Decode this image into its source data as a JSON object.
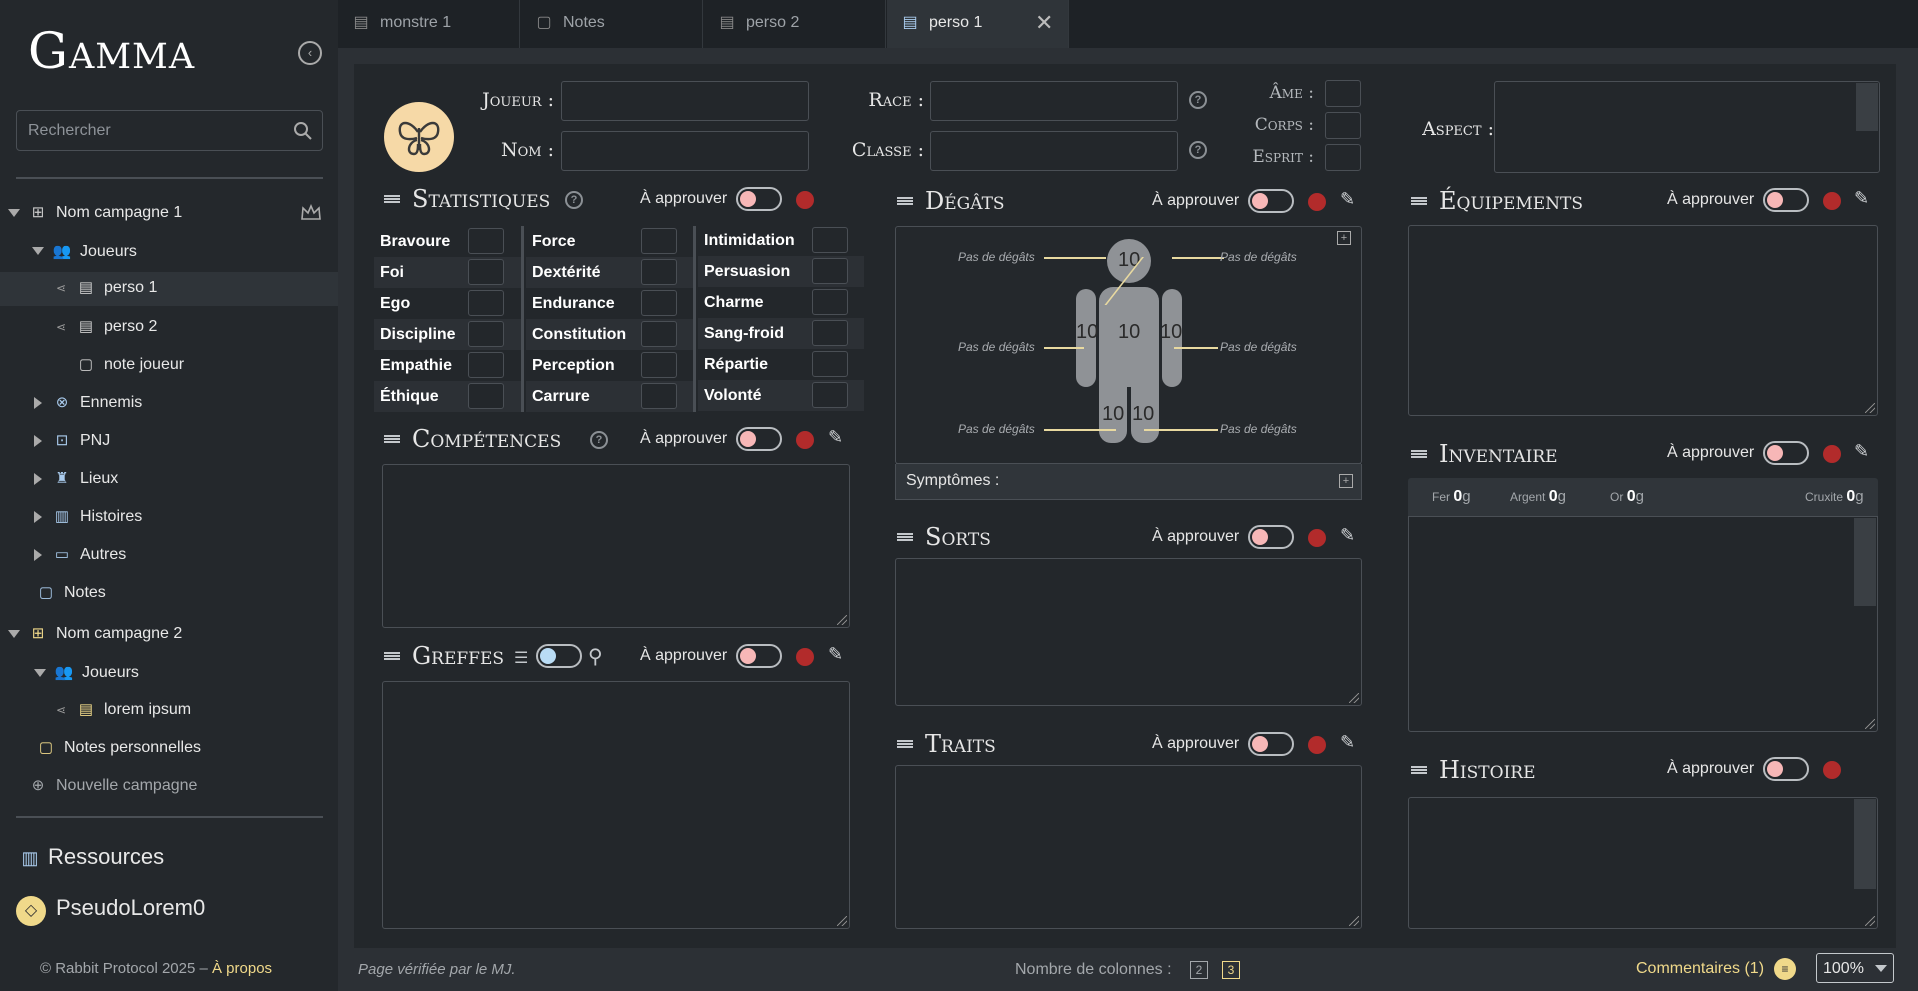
{
  "app": {
    "logo": "Gamma",
    "collapse_icon": "chevron-left-icon"
  },
  "search": {
    "placeholder": "Rechercher",
    "icon": "search-icon"
  },
  "tree": [
    {
      "label": "Nom campagne 1",
      "icon": "map-icon"
    },
    {
      "label": "Joueurs",
      "icon": "users-icon"
    },
    {
      "label": "perso 1",
      "icon": "document-icon"
    },
    {
      "label": "perso 2",
      "icon": "document-icon"
    },
    {
      "label": "note joueur",
      "icon": "note-icon"
    },
    {
      "label": "Ennemis",
      "icon": "skull-icon"
    },
    {
      "label": "PNJ",
      "icon": "robot-icon"
    },
    {
      "label": "Lieux",
      "icon": "castle-icon"
    },
    {
      "label": "Histoires",
      "icon": "book-icon"
    },
    {
      "label": "Autres",
      "icon": "folder-icon"
    },
    {
      "label": "Notes",
      "icon": "note-icon"
    },
    {
      "label": "Nom campagne 2",
      "icon": "map-icon"
    },
    {
      "label": "Joueurs",
      "icon": "users-icon"
    },
    {
      "label": "lorem ipsum",
      "icon": "document-icon"
    },
    {
      "label": "Notes personnelles",
      "icon": "note-icon"
    },
    {
      "label": "Nouvelle campagne",
      "icon": "plus-circle-icon"
    }
  ],
  "resources": {
    "label": "Ressources"
  },
  "user": {
    "name": "PseudoLorem0"
  },
  "copyright": {
    "text": "© Rabbit Protocol 2025 – ",
    "link": "À propos"
  },
  "tabs": [
    {
      "label": "monstre 1"
    },
    {
      "label": "Notes"
    },
    {
      "label": "perso 2"
    },
    {
      "label": "perso 1"
    }
  ],
  "header": {
    "joueur": "Joueur :",
    "nom": "Nom :",
    "race": "Race :",
    "classe": "Classe :",
    "ame": "Âme :",
    "corps": "Corps :",
    "esprit": "Esprit :",
    "aspect": "Aspect :"
  },
  "approve": "À approuver",
  "sections": {
    "statistiques": "Statistiques",
    "competences": "Compétences",
    "greffes": "Greffes",
    "degats": "Dégâts",
    "sorts": "Sorts",
    "traits": "Traits",
    "equipements": "Équipements",
    "inventaire": "Inventaire",
    "histoire": "Histoire"
  },
  "stats": {
    "col1": [
      "Bravoure",
      "Foi",
      "Ego",
      "Discipline",
      "Empathie",
      "Éthique"
    ],
    "col2": [
      "Force",
      "Dextérité",
      "Endurance",
      "Constitution",
      "Perception",
      "Carrure"
    ],
    "col3": [
      "Intimidation",
      "Persuasion",
      "Charme",
      "Sang-froid",
      "Répartie",
      "Volonté"
    ]
  },
  "damage": {
    "head": "10",
    "torso": "10",
    "left_arm": "10",
    "right_arm": "10",
    "left_leg": "10",
    "right_leg": "10",
    "no_damage": "Pas de dégâts",
    "symptoms": "Symptômes :"
  },
  "currency": {
    "fer_label": "Fer",
    "fer_val": "0",
    "argent_label": "Argent",
    "argent_val": "0",
    "or_label": "Or",
    "or_val": "0",
    "cruxite_label": "Cruxite",
    "cruxite_val": "0",
    "unit": "g"
  },
  "footer": {
    "verified": "Page vérifiée par le MJ.",
    "columns_label": "Nombre de colonnes :",
    "col2": "2",
    "col3": "3",
    "comments": "Commentaires (1)",
    "zoom": "100%"
  },
  "colors": {
    "accent": "#f0d98a",
    "danger": "#b22b2b",
    "toggle_knob": "#f7b7b7"
  }
}
